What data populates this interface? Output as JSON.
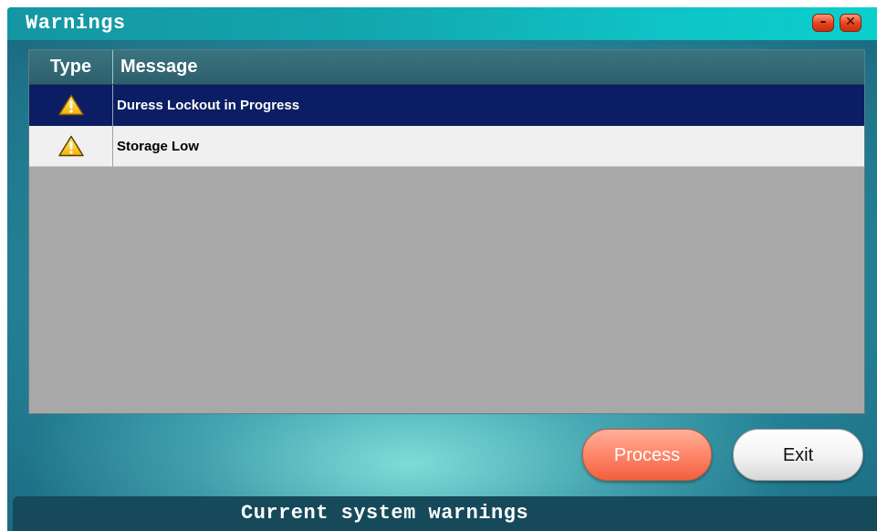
{
  "window": {
    "title": "Warnings"
  },
  "table": {
    "columns": {
      "type": "Type",
      "message": "Message"
    },
    "rows": [
      {
        "type_icon": "warning-triangle-icon",
        "message": "Duress Lockout in Progress",
        "selected": true
      },
      {
        "type_icon": "warning-triangle-icon",
        "message": "Storage Low",
        "selected": false
      }
    ]
  },
  "buttons": {
    "process": "Process",
    "exit": "Exit"
  },
  "status": {
    "text": "Current system warnings"
  },
  "colors": {
    "title_bar": "#0fc3c6",
    "selected_row": "#0b1e63",
    "process_button": "#ff8a6e",
    "warning_icon": "#ffc800"
  }
}
